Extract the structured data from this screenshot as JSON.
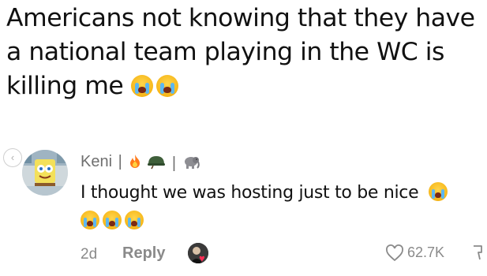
{
  "post": {
    "text_line": "Americans not knowing that they have a national team playing in the WC is killing me",
    "emojis": [
      "loudly-crying-face",
      "loudly-crying-face"
    ]
  },
  "comment": {
    "author": "Keni",
    "author_separator": "|",
    "author_badges": [
      "fire-emoji",
      "military-helmet-emoji",
      "elephant-emoji"
    ],
    "text": "I thought we was hosting just to be nice",
    "trailing_emojis": [
      "loudly-crying-face",
      "loudly-crying-face",
      "loudly-crying-face",
      "loudly-crying-face"
    ],
    "time": "2d",
    "reply_label": "Reply",
    "like_count": "62.7K"
  },
  "colors": {
    "text": "#111111",
    "muted": "#8a8a8a",
    "heart": "#ff2d55"
  }
}
